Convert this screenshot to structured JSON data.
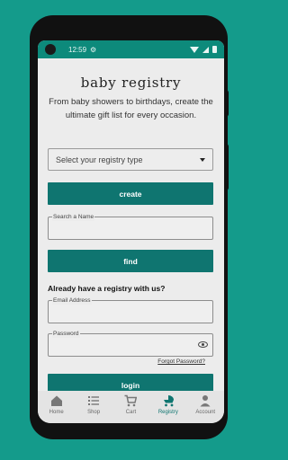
{
  "status_bar": {
    "time": "12:59",
    "settings_icon": "gear-icon"
  },
  "page": {
    "title": "baby registry",
    "subtitle": "From baby showers to birthdays, create the ultimate gift list for every occasion."
  },
  "registry_type": {
    "value": "Select your registry type",
    "icon": "chevron-down-icon"
  },
  "create_label": "create",
  "search": {
    "label": "Search a Name",
    "value": ""
  },
  "find_label": "find",
  "existing": {
    "heading": "Already have a registry with us?",
    "email_label": "Email Address",
    "email_value": "",
    "password_label": "Password",
    "password_value": "",
    "forgot_label": "Forgot Password?",
    "login_label": "login"
  },
  "bottom_nav": [
    {
      "label": "Home",
      "icon": "home-icon",
      "active": false
    },
    {
      "label": "Shop",
      "icon": "list-icon",
      "active": false
    },
    {
      "label": "Cart",
      "icon": "cart-icon",
      "active": false
    },
    {
      "label": "Registry",
      "icon": "stroller-icon",
      "active": true
    },
    {
      "label": "Account",
      "icon": "person-icon",
      "active": false
    }
  ],
  "colors": {
    "brand": "#0f7570",
    "status_bar": "#0d8a7b",
    "background": "#149b8b"
  }
}
